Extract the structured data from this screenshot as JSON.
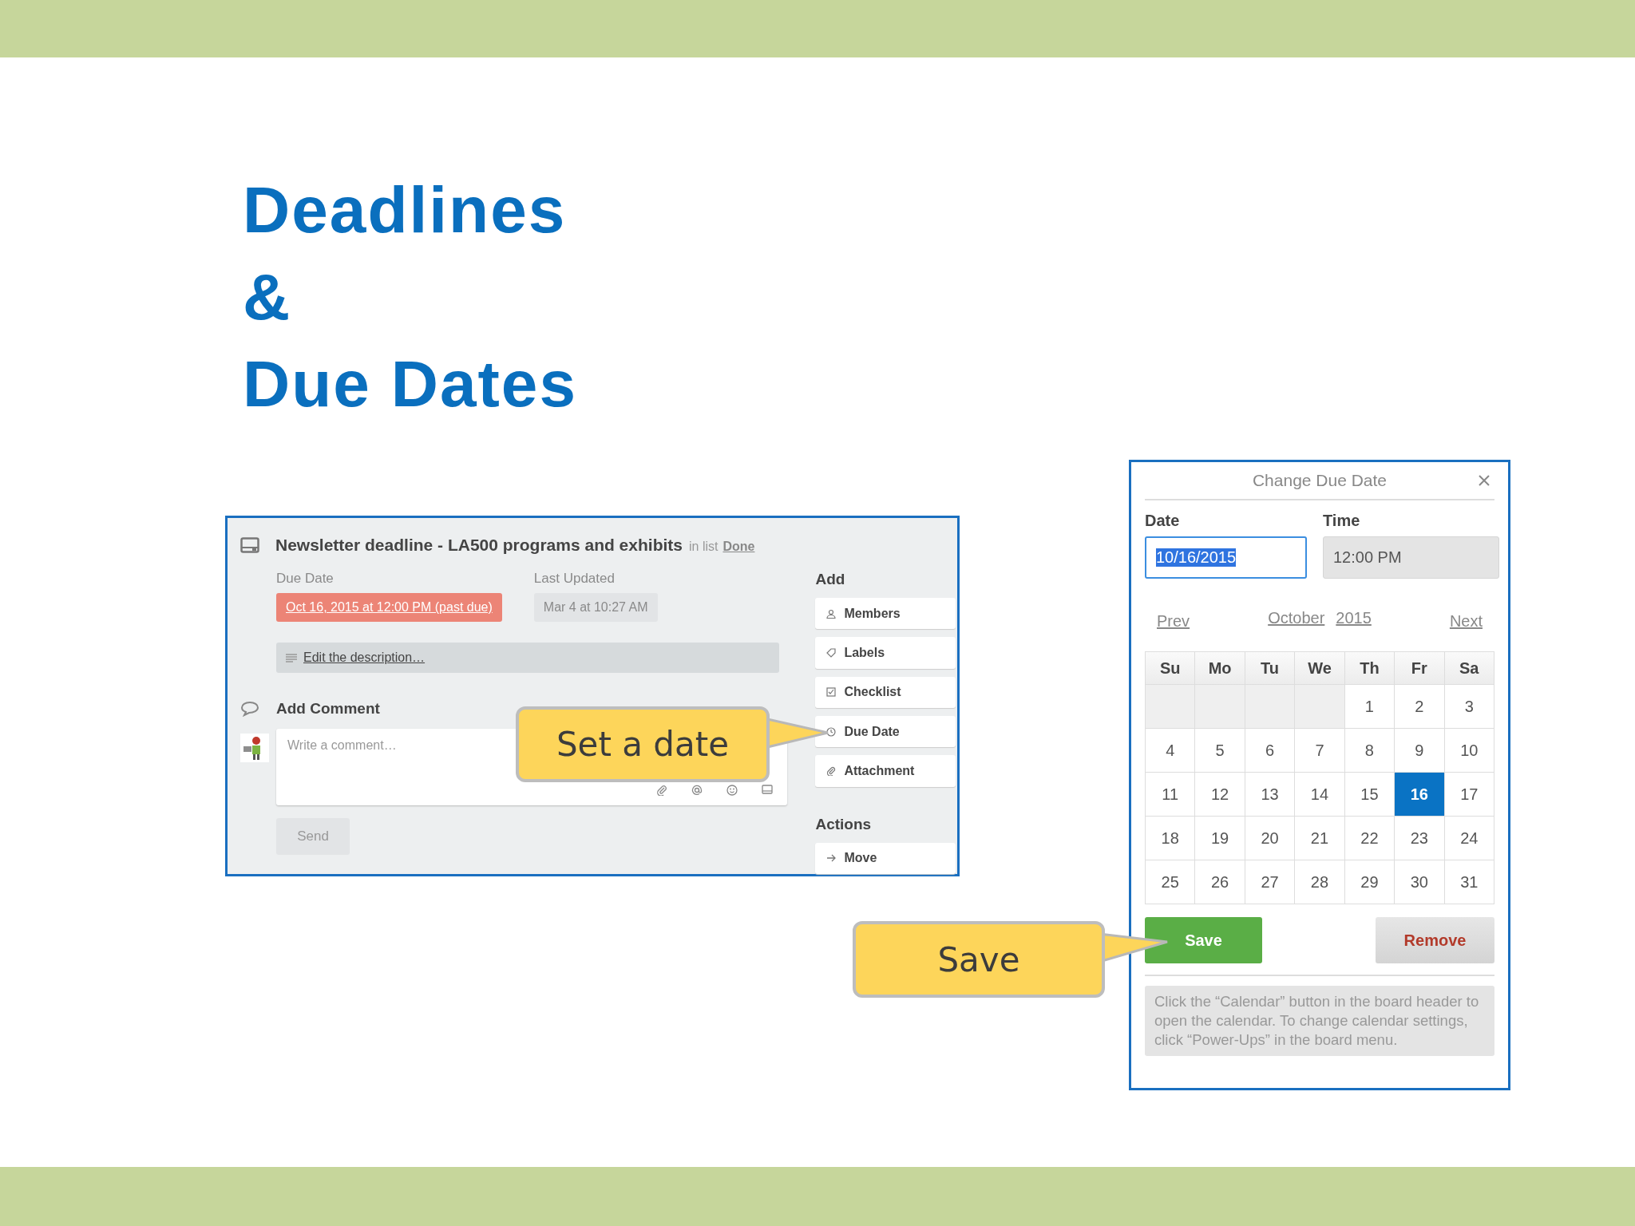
{
  "slide": {
    "title_lines": [
      "Deadlines",
      "&",
      "Due Dates"
    ]
  },
  "card": {
    "title": "Newsletter deadline - LA500 programs and exhibits",
    "list_prefix": "in list",
    "list_name": "Done",
    "due_label": "Due Date",
    "due_value": "Oct 16, 2015 at 12:00 PM (past due)",
    "past_due": true,
    "updated_label": "Last Updated",
    "updated_value": "Mar 4 at 10:27 AM",
    "description_link": "Edit the description…",
    "comment_heading": "Add Comment",
    "comment_placeholder": "Write a comment…",
    "send_button": "Send",
    "add_heading": "Add",
    "add_buttons": [
      "Members",
      "Labels",
      "Checklist",
      "Due Date",
      "Attachment"
    ],
    "actions_heading": "Actions",
    "action_buttons": [
      "Move"
    ]
  },
  "callouts": [
    {
      "text": "Set a date"
    },
    {
      "text": "Save"
    }
  ],
  "due_dialog": {
    "title": "Change Due Date",
    "date_label": "Date",
    "date_value": "10/16/2015",
    "time_label": "Time",
    "time_value": "12:00 PM",
    "prev": "Prev",
    "month": "October",
    "year": "2015",
    "next": "Next",
    "weekdays": [
      "Su",
      "Mo",
      "Tu",
      "We",
      "Th",
      "Fr",
      "Sa"
    ],
    "weeks": [
      [
        {
          "kind": "blank"
        },
        {
          "kind": "blank"
        },
        {
          "kind": "blank"
        },
        {
          "kind": "blank"
        },
        {
          "day": "1",
          "selected": false
        },
        {
          "day": "2",
          "selected": false
        },
        {
          "day": "3",
          "selected": false
        }
      ],
      [
        {
          "day": "4",
          "selected": false
        },
        {
          "day": "5",
          "selected": false
        },
        {
          "day": "6",
          "selected": false
        },
        {
          "day": "7",
          "selected": false
        },
        {
          "day": "8",
          "selected": false
        },
        {
          "day": "9",
          "selected": false
        },
        {
          "day": "10",
          "selected": false
        }
      ],
      [
        {
          "day": "11",
          "selected": false
        },
        {
          "day": "12",
          "selected": false
        },
        {
          "day": "13",
          "selected": false
        },
        {
          "day": "14",
          "selected": false
        },
        {
          "day": "15",
          "selected": false
        },
        {
          "day": "16",
          "selected": true
        },
        {
          "day": "17",
          "selected": false
        }
      ],
      [
        {
          "day": "18",
          "selected": false
        },
        {
          "day": "19",
          "selected": false
        },
        {
          "day": "20",
          "selected": false
        },
        {
          "day": "21",
          "selected": false
        },
        {
          "day": "22",
          "selected": false
        },
        {
          "day": "23",
          "selected": false
        },
        {
          "day": "24",
          "selected": false
        }
      ],
      [
        {
          "day": "25",
          "selected": false
        },
        {
          "day": "26",
          "selected": false
        },
        {
          "day": "27",
          "selected": false
        },
        {
          "day": "28",
          "selected": false
        },
        {
          "day": "29",
          "selected": false
        },
        {
          "day": "30",
          "selected": false
        },
        {
          "day": "31",
          "selected": false
        }
      ]
    ],
    "save_button": "Save",
    "remove_button": "Remove",
    "note": "Click the “Calendar” button in the board header to open the calendar. To change calendar settings, click “Power-Ups” in the board menu."
  }
}
